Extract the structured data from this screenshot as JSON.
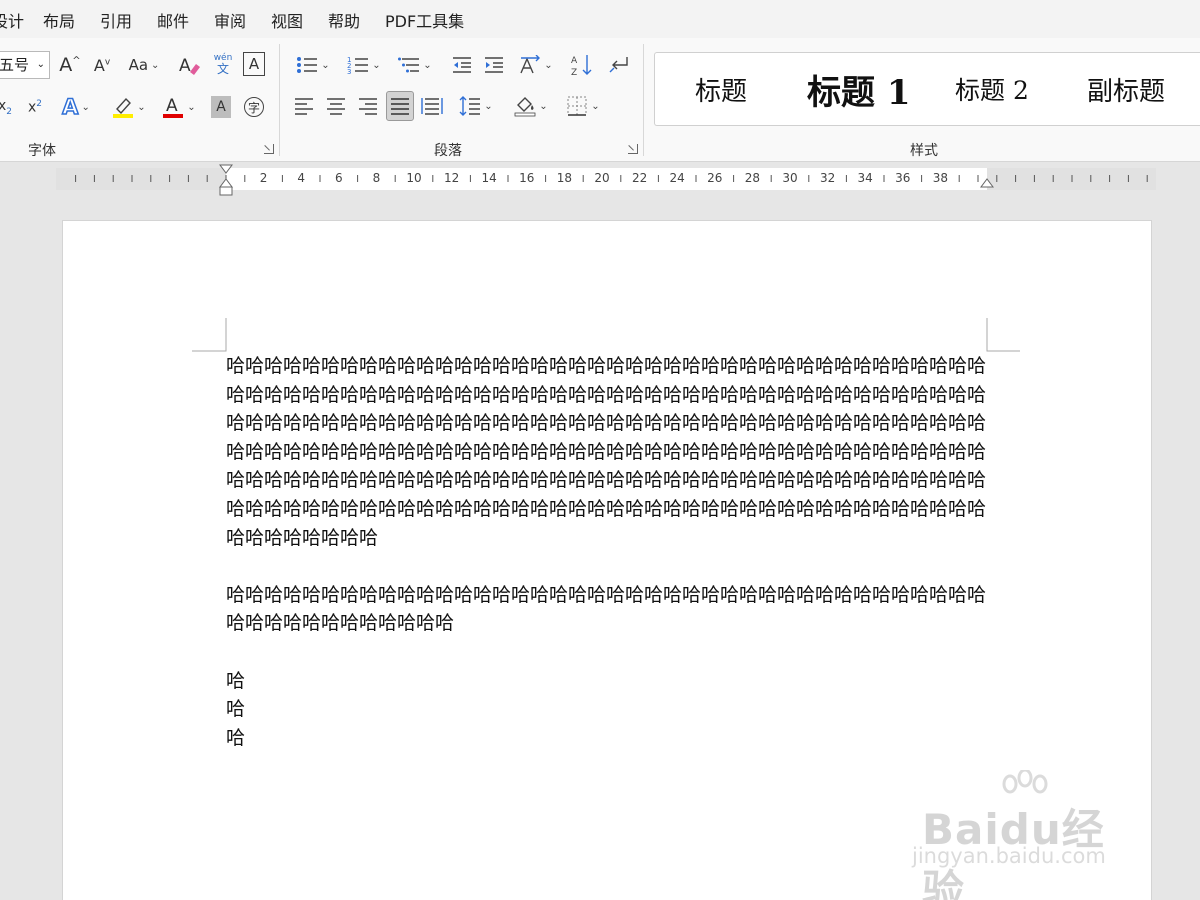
{
  "menu": {
    "tabs": [
      "设计",
      "布局",
      "引用",
      "邮件",
      "审阅",
      "视图",
      "帮助",
      "PDF工具集"
    ]
  },
  "ribbon": {
    "font_group": {
      "label": "字体",
      "font_size_value": "五号",
      "change_case_label": "Aa",
      "phonetic_top": "wén",
      "phonetic_bottom": "文",
      "enclose_char": "字",
      "char_border": "A",
      "char_shading": "A"
    },
    "paragraph_group": {
      "label": "段落"
    },
    "styles_group": {
      "label": "样式",
      "items": [
        "标题",
        "标题 1",
        "标题 2",
        "副标题"
      ]
    }
  },
  "ruler": {
    "numbers": [
      "2",
      "4",
      "6",
      "8",
      "10",
      "12",
      "14",
      "16",
      "18",
      "20",
      "22",
      "24",
      "26",
      "28",
      "30",
      "32",
      "34",
      "36",
      "38"
    ]
  },
  "document": {
    "paragraphs": [
      "哈哈哈哈哈哈哈哈哈哈哈哈哈哈哈哈哈哈哈哈哈哈哈哈哈哈哈哈哈哈哈哈哈哈哈哈哈哈哈哈哈哈哈哈哈哈哈哈哈哈哈哈哈哈哈哈哈哈哈哈哈哈哈哈哈哈哈哈哈哈哈哈哈哈哈哈哈哈哈哈哈哈哈哈哈哈哈哈哈哈哈哈哈哈哈哈哈哈哈哈哈哈哈哈哈哈哈哈哈哈哈哈哈哈哈哈哈哈哈哈哈哈哈哈哈哈哈哈哈哈哈哈哈哈哈哈哈哈哈哈哈哈哈哈哈哈哈哈哈哈哈哈哈哈哈哈哈哈哈哈哈哈哈哈哈哈哈哈哈哈哈哈哈哈哈哈哈哈哈哈哈哈哈哈哈哈哈哈哈哈哈哈哈哈哈哈哈哈哈哈哈哈哈哈哈哈哈哈哈哈哈哈哈哈哈哈哈哈哈哈哈哈哈哈哈哈哈哈哈哈哈哈哈哈哈哈哈哈哈哈哈哈哈哈哈哈哈哈",
      "",
      "哈哈哈哈哈哈哈哈哈哈哈哈哈哈哈哈哈哈哈哈哈哈哈哈哈哈哈哈哈哈哈哈哈哈哈哈哈哈哈哈哈哈哈哈哈哈哈哈哈哈哈哈",
      "",
      "哈",
      "哈",
      "哈"
    ]
  },
  "watermark": {
    "brand": "Baidu经验",
    "url": "jingyan.baidu.com"
  }
}
